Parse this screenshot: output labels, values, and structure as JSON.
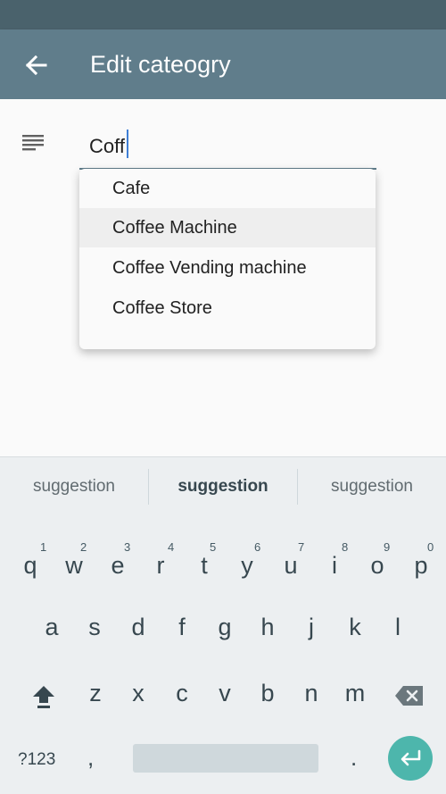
{
  "app_bar": {
    "title": "Edit cateogry",
    "back_icon": "arrow-back-icon",
    "color": "#607d8b",
    "status_bar_color": "#4a626c"
  },
  "form": {
    "notes_icon": "notes-icon",
    "input_value": "Coff",
    "underline_color": "#607d8b",
    "caret_color": "#3f7fd6"
  },
  "dropdown": {
    "options": [
      "Cafe",
      "Coffee Machine",
      "Coffee Vending machine",
      "Coffee Store"
    ],
    "highlighted_index": 1
  },
  "suggestions": [
    "suggestion",
    "suggestion",
    "suggestion"
  ],
  "keyboard": {
    "row1": [
      {
        "letter": "q",
        "num": "1"
      },
      {
        "letter": "w",
        "num": "2"
      },
      {
        "letter": "e",
        "num": "3"
      },
      {
        "letter": "r",
        "num": "4"
      },
      {
        "letter": "t",
        "num": "5"
      },
      {
        "letter": "y",
        "num": "6"
      },
      {
        "letter": "u",
        "num": "7"
      },
      {
        "letter": "i",
        "num": "8"
      },
      {
        "letter": "o",
        "num": "9"
      },
      {
        "letter": "p",
        "num": "0"
      }
    ],
    "row2": [
      "a",
      "s",
      "d",
      "f",
      "g",
      "h",
      "j",
      "k",
      "l"
    ],
    "row3": [
      "z",
      "x",
      "c",
      "v",
      "b",
      "n",
      "m"
    ],
    "symbols_label": "?123",
    "comma_label": ",",
    "period_label": ".",
    "shift_icon": "shift-icon",
    "backspace_icon": "backspace-icon",
    "enter_icon": "enter-icon",
    "enter_color": "#4db6ac"
  }
}
